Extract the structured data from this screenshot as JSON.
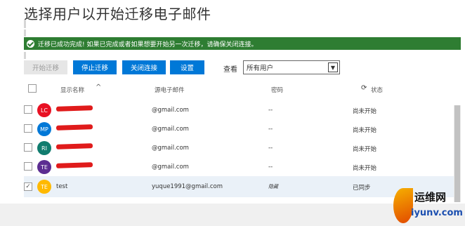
{
  "page": {
    "title": "选择用户以开始迁移电子邮件"
  },
  "banner": {
    "message": "迁移已成功完成! 如果已完成或者如果想要开始另一次迁移，请确保关闭连接。"
  },
  "toolbar": {
    "start_label": "开始迁移",
    "stop_label": "停止迁移",
    "close_label": "关闭连接",
    "settings_label": "设置",
    "view_label": "查看",
    "view_selected": "所有用户"
  },
  "columns": {
    "display_name": "显示名称",
    "source_email": "源电子邮件",
    "password": "密码",
    "status": "状态"
  },
  "rows": [
    {
      "initials": "LC",
      "name": "",
      "email": "@gmail.com",
      "password": "--",
      "status": "尚未开始",
      "avatar_color": "#e81123",
      "checked": ""
    },
    {
      "initials": "MP",
      "name": "",
      "email": "@gmail.com",
      "password": "--",
      "status": "尚未开始",
      "avatar_color": "#0078d7",
      "checked": ""
    },
    {
      "initials": "RI",
      "name": "",
      "email": "@gmail.com",
      "password": "--",
      "status": "尚未开始",
      "avatar_color": "#107c6e",
      "checked": ""
    },
    {
      "initials": "TE",
      "name": "",
      "email": "@gmail.com",
      "password": "--",
      "status": "尚未开始",
      "avatar_color": "#5c2d91",
      "checked": ""
    },
    {
      "initials": "TE",
      "name": "test",
      "email": "yuque1991@gmail.com",
      "password": "隐藏",
      "status": "已同步",
      "avatar_color": "#ffb900",
      "checked": "✓"
    }
  ],
  "watermark": {
    "text_cn": "运维网",
    "text_en": "iyunv.com"
  }
}
